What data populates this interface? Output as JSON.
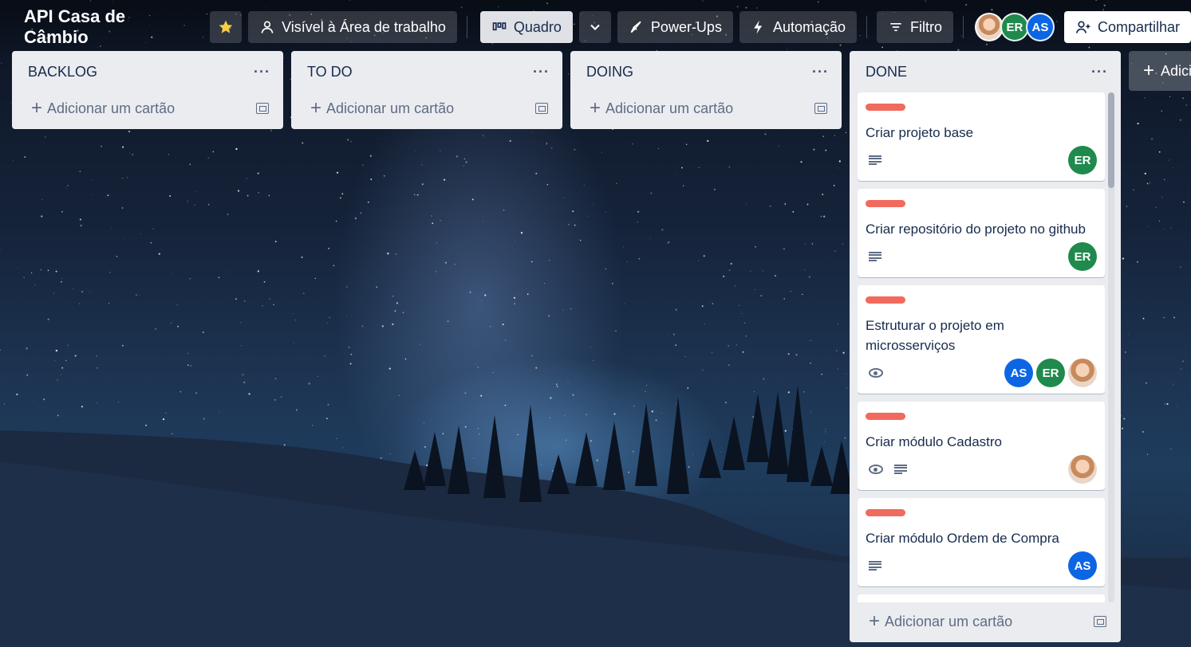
{
  "header": {
    "board_title": "API Casa de Câmbio",
    "visibility_label": "Visível à Área de trabalho",
    "view_label": "Quadro",
    "powerups_label": "Power-Ups",
    "automation_label": "Automação",
    "filter_label": "Filtro",
    "members": [
      "ER",
      "AS"
    ],
    "share_label": "Compartilhar"
  },
  "lists": [
    {
      "title": "BACKLOG",
      "add_label": "Adicionar um cartão"
    },
    {
      "title": "TO DO",
      "add_label": "Adicionar um cartão"
    },
    {
      "title": "DOING",
      "add_label": "Adicionar um cartão"
    },
    {
      "title": "DONE",
      "add_label": "Adicionar um cartão"
    }
  ],
  "done_cards": [
    {
      "title": "Criar projeto base",
      "members": [
        "ER"
      ]
    },
    {
      "title": "Criar repositório do projeto no github",
      "members": [
        "ER"
      ]
    },
    {
      "title": "Estruturar o projeto em microsserviços",
      "members": [
        "AS",
        "ER"
      ]
    },
    {
      "title": "Criar módulo Cadastro",
      "members": []
    },
    {
      "title": "Criar módulo Ordem de Compra",
      "members": [
        "AS"
      ]
    }
  ],
  "add_list_label": "Adicionar outra lista",
  "colors": {
    "label_red": "#f06a5e",
    "member_er": "#1f8a4c",
    "member_as": "#0c66e4",
    "list_bg": "#ebecf0"
  }
}
